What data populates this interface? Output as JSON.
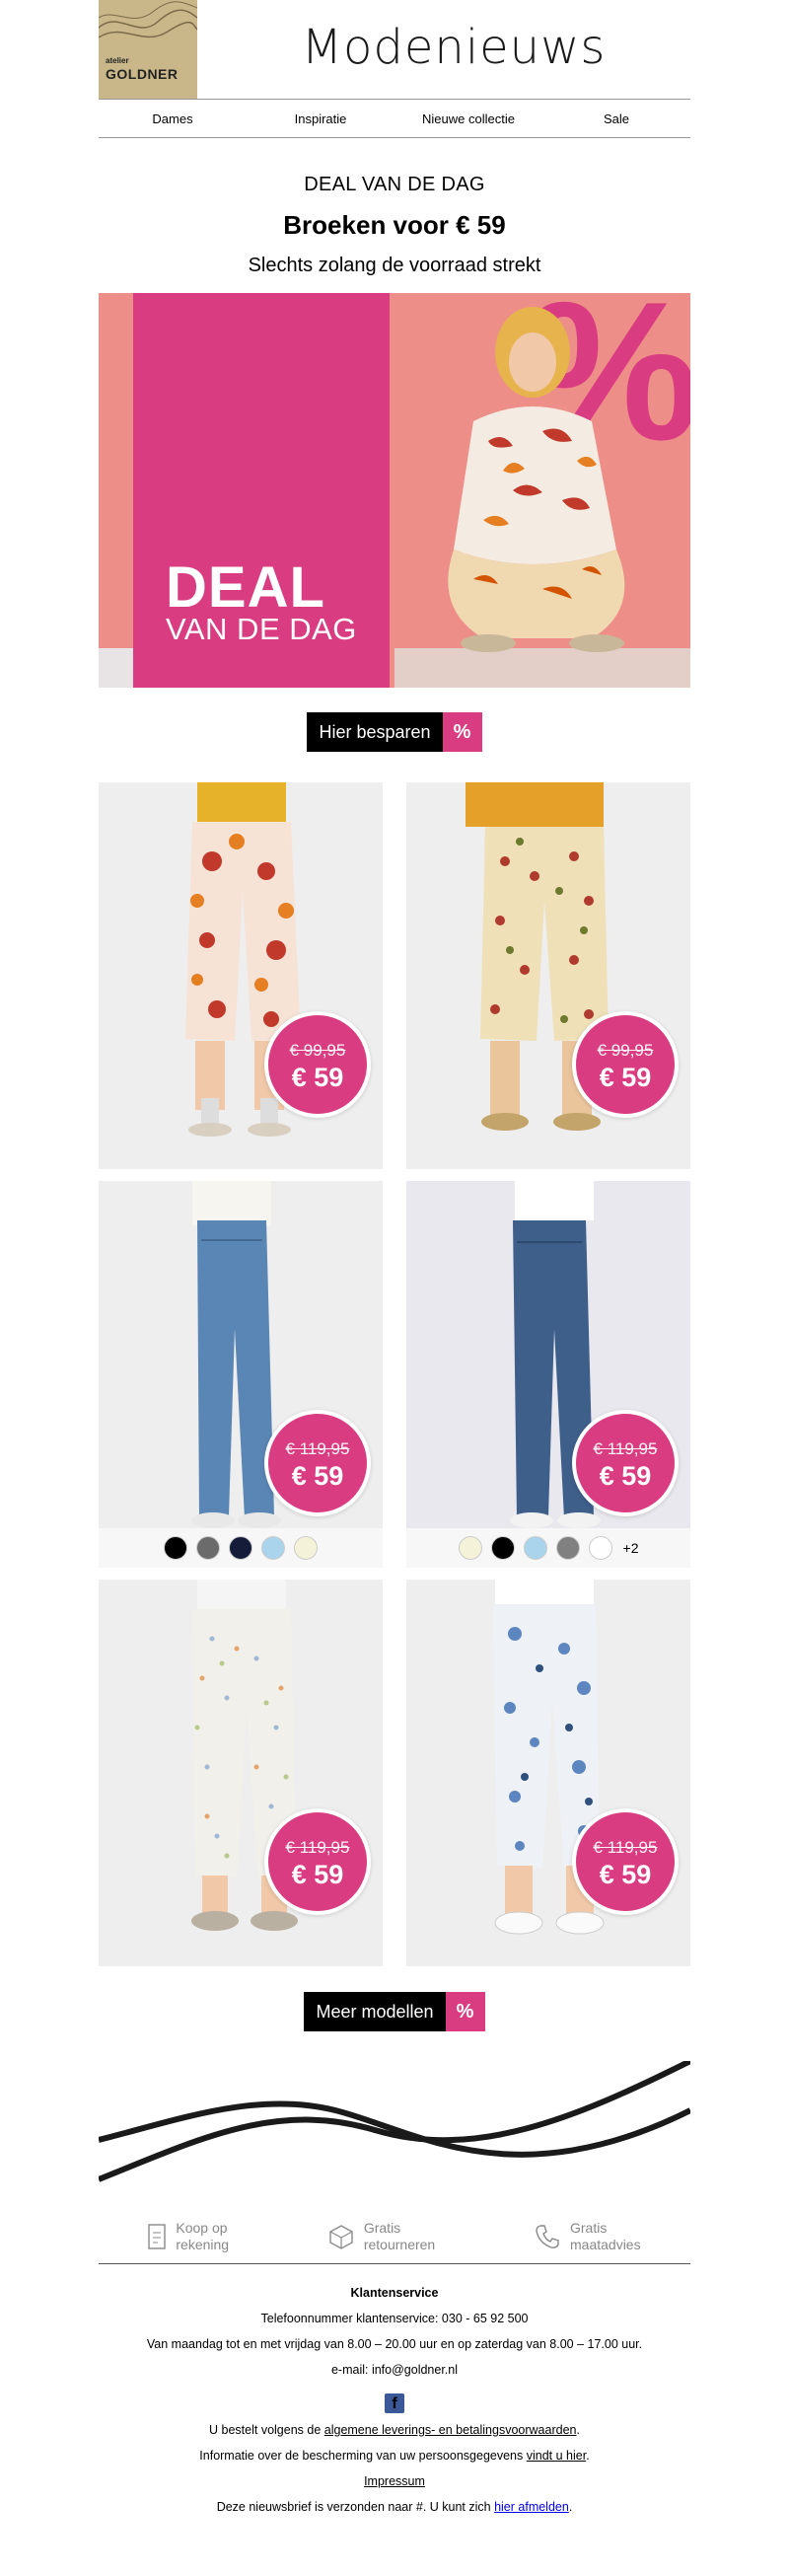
{
  "header": {
    "logo_small": "atelier",
    "logo_name": "GOLDNER",
    "title": "Modenieuws"
  },
  "nav": [
    "Dames",
    "Inspiratie",
    "Nieuwe collectie",
    "Sale"
  ],
  "deal": {
    "kicker": "DEAL VAN DE DAG",
    "title": "Broeken voor € 59",
    "subtitle": "Slechts zolang de voorraad strekt",
    "banner_line1": "DEAL",
    "banner_line2": "VAN DE DAG",
    "banner_symbol": "%"
  },
  "cta_top": {
    "label": "Hier besparen",
    "symbol": "%"
  },
  "products": [
    {
      "old_price": "€ 99,95",
      "new_price": "€ 59",
      "pattern": "palm-print-capri"
    },
    {
      "old_price": "€ 99,95",
      "new_price": "€ 59",
      "pattern": "floral-print-capri"
    },
    {
      "old_price": "€ 119,95",
      "new_price": "€ 59",
      "pattern": "light-denim",
      "swatches": [
        "#000000",
        "#6b6b6b",
        "#141c3a",
        "#a9d4ec",
        "#f4f2d8"
      ]
    },
    {
      "old_price": "€ 119,95",
      "new_price": "€ 59",
      "pattern": "dark-denim",
      "swatches": [
        "#f4f2d8",
        "#000000",
        "#a9d4ec",
        "#808080",
        "#ffffff"
      ],
      "more": "+2"
    },
    {
      "old_price": "€ 119,95",
      "new_price": "€ 59",
      "pattern": "white-dotted"
    },
    {
      "old_price": "€ 119,95",
      "new_price": "€ 59",
      "pattern": "blue-floral"
    }
  ],
  "cta_bottom": {
    "label": "Meer modellen",
    "symbol": "%"
  },
  "usps": [
    {
      "icon": "invoice-icon",
      "line1": "Koop op",
      "line2": "rekening"
    },
    {
      "icon": "box-icon",
      "line1": "Gratis",
      "line2": "retourneren"
    },
    {
      "icon": "phone-icon",
      "line1": "Gratis",
      "line2": "maatadvies"
    }
  ],
  "footer": {
    "title": "Klantenservice",
    "phone": "Telefoonnummer klantenservice: 030 - 65 92 500",
    "hours": "Van maandag tot en met vrijdag van 8.00 – 20.00 uur en op zaterdag van 8.00 – 17.00 uur.",
    "email": "e-mail: info@goldner.nl",
    "facebook": "f",
    "terms_pre": "U bestelt volgens de ",
    "terms_link": "algemene leverings- en betalingsvoorwaarden",
    "terms_post": ".",
    "privacy_pre": "Informatie over de bescherming van uw persoonsgegevens ",
    "privacy_link": "vindt u hier",
    "privacy_post": ".",
    "impressum": "Impressum",
    "unsub_pre": "Deze nieuwsbrief is verzonden naar #. U kunt zich ",
    "unsub_link": "hier afmelden",
    "unsub_post": "."
  },
  "colors": {
    "accent": "#d93c80",
    "logo_bg": "#c9b78a",
    "hero_bg": "#ee8e88"
  }
}
